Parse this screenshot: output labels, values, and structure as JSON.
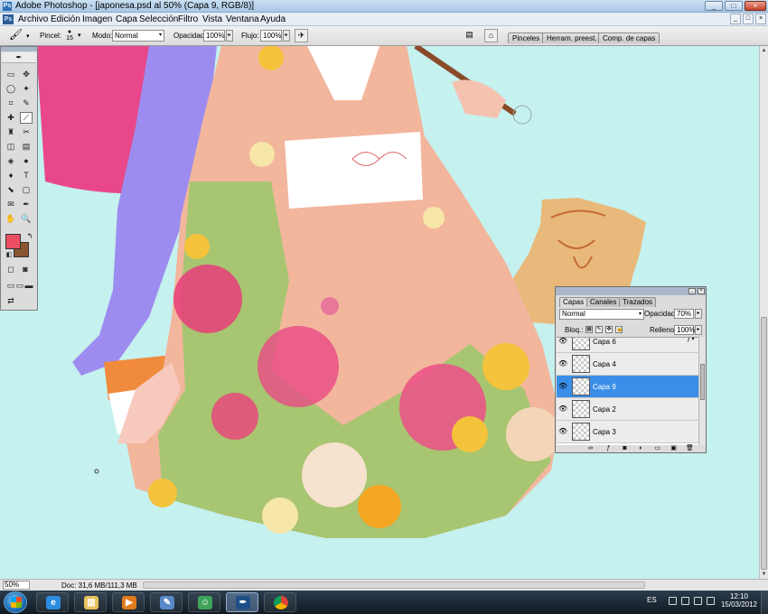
{
  "window": {
    "app_icon_label": "Ps",
    "title": "Adobe Photoshop - [japonesa.psd al 50% (Capa 9, RGB/8)]",
    "controls": [
      "_",
      "□",
      "×"
    ]
  },
  "menubar": {
    "items": [
      "Archivo",
      "Edición",
      "Imagen",
      "Capa",
      "Selección",
      "Filtro",
      "Vista",
      "Ventana",
      "Ayuda"
    ],
    "doc_controls": [
      "_",
      "□",
      "×"
    ]
  },
  "options_bar": {
    "brush_label": "Pincel:",
    "brush_size": "15",
    "mode_label": "Modo:",
    "mode_value": "Normal",
    "opacity_label": "Opacidad:",
    "opacity_value": "100%",
    "flow_label": "Flujo:",
    "flow_value": "100%",
    "panel_tabs": [
      "Pinceles",
      "Herram. preest.",
      "Comp. de capas"
    ]
  },
  "canvas": {
    "colors": {
      "background": "#c5f1ef",
      "hair": "#9d8cf0",
      "umbrella": "#e8488a",
      "kimono": "#f2b69c",
      "sleeve_green": "#9bc86a",
      "dog": "#e8b97a"
    }
  },
  "statusbar": {
    "zoom": "50%",
    "doc_info": "Doc: 31,6 MB/111,3 MB"
  },
  "tools": {
    "foreground_color": "#ec4f63",
    "background_color": "#8a5632",
    "rows": [
      [
        "▭",
        "✥"
      ],
      [
        "◯",
        "✦"
      ],
      [
        "⌗",
        "✎"
      ],
      [
        "✚",
        "⟋"
      ],
      [
        "♜",
        "✂"
      ],
      [
        "◫",
        "▤"
      ],
      [
        "◈",
        "●"
      ],
      [
        "♦",
        "T"
      ],
      [
        "⬊",
        "▢"
      ],
      [
        "✉",
        "✒"
      ],
      [
        "✋",
        "🔍"
      ]
    ]
  },
  "layers_panel": {
    "tabs": [
      "Capas",
      "Canales",
      "Trazados"
    ],
    "blend_mode": "Normal",
    "opacity_label": "Opacidad:",
    "opacity_value": "70%",
    "lock_label": "Bloq.:",
    "fill_label": "Relleno:",
    "fill_value": "100%",
    "layers": [
      {
        "name": "Capa 6",
        "selected": false,
        "fx": true
      },
      {
        "name": "Capa 4",
        "selected": false,
        "fx": false
      },
      {
        "name": "Capa 9",
        "selected": true,
        "fx": false
      },
      {
        "name": "Capa 2",
        "selected": false,
        "fx": false
      },
      {
        "name": "Capa 3",
        "selected": false,
        "fx": false
      }
    ]
  },
  "taskbar": {
    "apps": [
      "internet-explorer",
      "file-explorer",
      "media-player",
      "paint",
      "messenger",
      "photoshop",
      "chrome"
    ],
    "language": "ES",
    "time": "12:10",
    "date": "15/03/2012"
  }
}
